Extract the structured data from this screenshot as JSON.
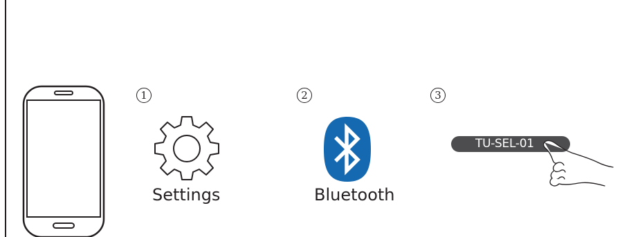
{
  "steps": [
    {
      "number": "1",
      "label": "Settings",
      "icon": "gear-icon"
    },
    {
      "number": "2",
      "label": "Bluetooth",
      "icon": "bluetooth-icon"
    },
    {
      "number": "3",
      "device_name": "TU-SEL-01",
      "icon": "hand-tap-icon"
    }
  ],
  "colors": {
    "bluetooth": "#1569b0",
    "pill": "#4d4d4f",
    "line": "#231f20"
  }
}
